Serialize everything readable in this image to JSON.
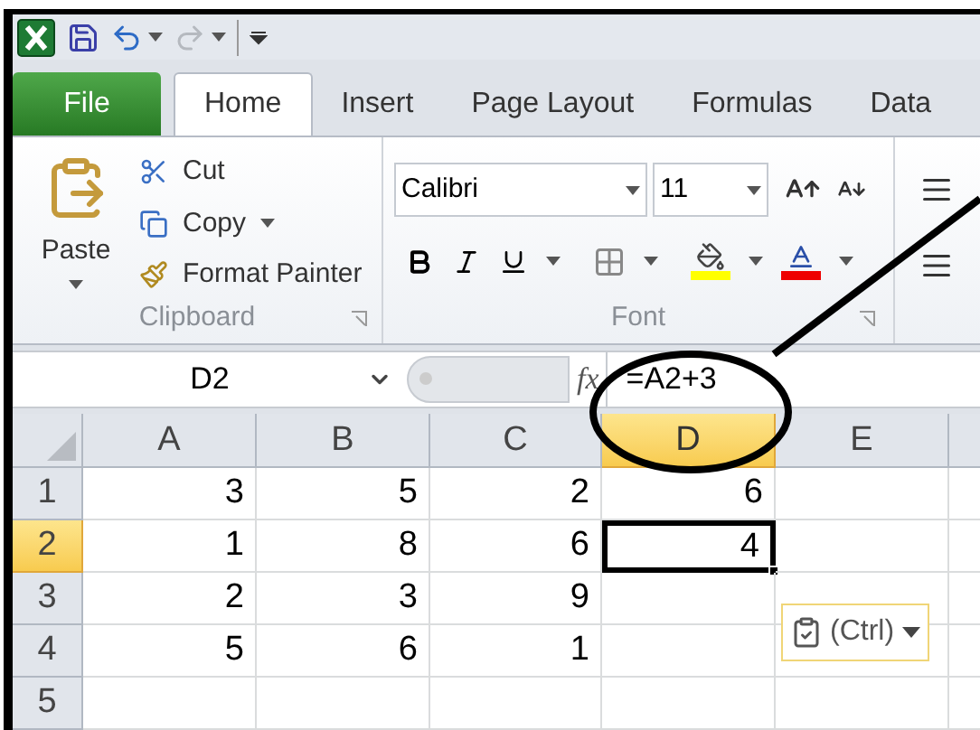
{
  "quick_access": {
    "redo_disabled": true
  },
  "tabs": [
    {
      "label": "File",
      "kind": "file",
      "selected": false
    },
    {
      "label": "Home",
      "kind": "tab",
      "selected": true
    },
    {
      "label": "Insert",
      "kind": "tab",
      "selected": false
    },
    {
      "label": "Page Layout",
      "kind": "tab",
      "selected": false
    },
    {
      "label": "Formulas",
      "kind": "tab",
      "selected": false
    },
    {
      "label": "Data",
      "kind": "tab",
      "selected": false
    }
  ],
  "clipboard": {
    "paste": "Paste",
    "cut": "Cut",
    "copy": "Copy",
    "format_painter": "Format Painter",
    "label": "Clipboard"
  },
  "font": {
    "name": "Calibri",
    "size": "11",
    "label": "Font"
  },
  "formula_bar": {
    "name_box": "D2",
    "function_label": "fx",
    "formula": "=A2+3"
  },
  "columns": [
    {
      "label": "A",
      "selected": false
    },
    {
      "label": "B",
      "selected": false
    },
    {
      "label": "C",
      "selected": false
    },
    {
      "label": "D",
      "selected": true
    },
    {
      "label": "E",
      "selected": false
    }
  ],
  "rows": [
    {
      "header": "1",
      "selected": false,
      "cells": [
        {
          "value": "3",
          "selected": false
        },
        {
          "value": "5",
          "selected": false
        },
        {
          "value": "2",
          "selected": false
        },
        {
          "value": "6",
          "selected": false
        },
        {
          "selected": false
        }
      ]
    },
    {
      "header": "2",
      "selected": true,
      "cells": [
        {
          "value": "1",
          "selected": false
        },
        {
          "value": "8",
          "selected": false
        },
        {
          "value": "6",
          "selected": false
        },
        {
          "value": "4",
          "selected": true
        },
        {
          "selected": false
        }
      ]
    },
    {
      "header": "3",
      "selected": false,
      "cells": [
        {
          "value": "2",
          "selected": false
        },
        {
          "value": "3",
          "selected": false
        },
        {
          "value": "9",
          "selected": false
        },
        {
          "selected": false
        },
        {
          "selected": false
        }
      ]
    },
    {
      "header": "4",
      "selected": false,
      "cells": [
        {
          "value": "5",
          "selected": false
        },
        {
          "value": "6",
          "selected": false
        },
        {
          "value": "1",
          "selected": false
        },
        {
          "selected": false
        },
        {
          "selected": false
        }
      ]
    },
    {
      "header": "5",
      "selected": false,
      "cells": [
        {
          "selected": false
        },
        {
          "selected": false
        },
        {
          "selected": false
        },
        {
          "selected": false
        },
        {
          "selected": false
        }
      ]
    }
  ],
  "paste_options": {
    "label": "(Ctrl)"
  }
}
